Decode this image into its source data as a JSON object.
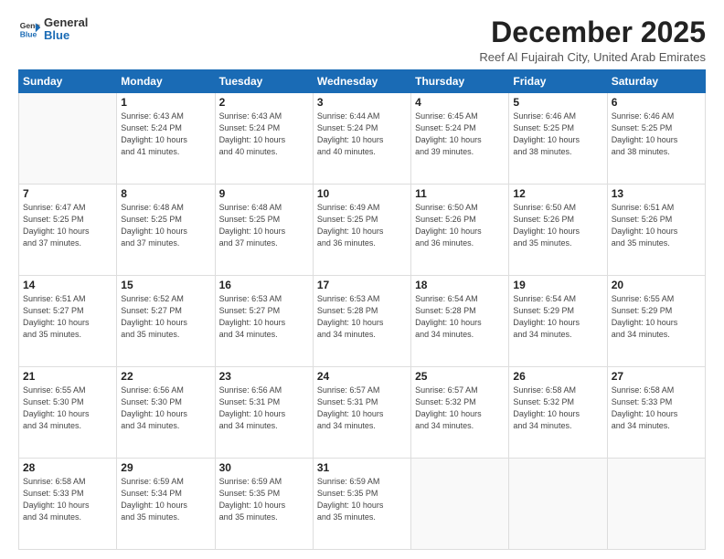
{
  "logo": {
    "general": "General",
    "blue": "Blue"
  },
  "header": {
    "month": "December 2025",
    "location": "Reef Al Fujairah City, United Arab Emirates"
  },
  "weekdays": [
    "Sunday",
    "Monday",
    "Tuesday",
    "Wednesday",
    "Thursday",
    "Friday",
    "Saturday"
  ],
  "weeks": [
    [
      {
        "day": "",
        "info": ""
      },
      {
        "day": "1",
        "info": "Sunrise: 6:43 AM\nSunset: 5:24 PM\nDaylight: 10 hours\nand 41 minutes."
      },
      {
        "day": "2",
        "info": "Sunrise: 6:43 AM\nSunset: 5:24 PM\nDaylight: 10 hours\nand 40 minutes."
      },
      {
        "day": "3",
        "info": "Sunrise: 6:44 AM\nSunset: 5:24 PM\nDaylight: 10 hours\nand 40 minutes."
      },
      {
        "day": "4",
        "info": "Sunrise: 6:45 AM\nSunset: 5:24 PM\nDaylight: 10 hours\nand 39 minutes."
      },
      {
        "day": "5",
        "info": "Sunrise: 6:46 AM\nSunset: 5:25 PM\nDaylight: 10 hours\nand 38 minutes."
      },
      {
        "day": "6",
        "info": "Sunrise: 6:46 AM\nSunset: 5:25 PM\nDaylight: 10 hours\nand 38 minutes."
      }
    ],
    [
      {
        "day": "7",
        "info": "Sunrise: 6:47 AM\nSunset: 5:25 PM\nDaylight: 10 hours\nand 37 minutes."
      },
      {
        "day": "8",
        "info": "Sunrise: 6:48 AM\nSunset: 5:25 PM\nDaylight: 10 hours\nand 37 minutes."
      },
      {
        "day": "9",
        "info": "Sunrise: 6:48 AM\nSunset: 5:25 PM\nDaylight: 10 hours\nand 37 minutes."
      },
      {
        "day": "10",
        "info": "Sunrise: 6:49 AM\nSunset: 5:25 PM\nDaylight: 10 hours\nand 36 minutes."
      },
      {
        "day": "11",
        "info": "Sunrise: 6:50 AM\nSunset: 5:26 PM\nDaylight: 10 hours\nand 36 minutes."
      },
      {
        "day": "12",
        "info": "Sunrise: 6:50 AM\nSunset: 5:26 PM\nDaylight: 10 hours\nand 35 minutes."
      },
      {
        "day": "13",
        "info": "Sunrise: 6:51 AM\nSunset: 5:26 PM\nDaylight: 10 hours\nand 35 minutes."
      }
    ],
    [
      {
        "day": "14",
        "info": "Sunrise: 6:51 AM\nSunset: 5:27 PM\nDaylight: 10 hours\nand 35 minutes."
      },
      {
        "day": "15",
        "info": "Sunrise: 6:52 AM\nSunset: 5:27 PM\nDaylight: 10 hours\nand 35 minutes."
      },
      {
        "day": "16",
        "info": "Sunrise: 6:53 AM\nSunset: 5:27 PM\nDaylight: 10 hours\nand 34 minutes."
      },
      {
        "day": "17",
        "info": "Sunrise: 6:53 AM\nSunset: 5:28 PM\nDaylight: 10 hours\nand 34 minutes."
      },
      {
        "day": "18",
        "info": "Sunrise: 6:54 AM\nSunset: 5:28 PM\nDaylight: 10 hours\nand 34 minutes."
      },
      {
        "day": "19",
        "info": "Sunrise: 6:54 AM\nSunset: 5:29 PM\nDaylight: 10 hours\nand 34 minutes."
      },
      {
        "day": "20",
        "info": "Sunrise: 6:55 AM\nSunset: 5:29 PM\nDaylight: 10 hours\nand 34 minutes."
      }
    ],
    [
      {
        "day": "21",
        "info": "Sunrise: 6:55 AM\nSunset: 5:30 PM\nDaylight: 10 hours\nand 34 minutes."
      },
      {
        "day": "22",
        "info": "Sunrise: 6:56 AM\nSunset: 5:30 PM\nDaylight: 10 hours\nand 34 minutes."
      },
      {
        "day": "23",
        "info": "Sunrise: 6:56 AM\nSunset: 5:31 PM\nDaylight: 10 hours\nand 34 minutes."
      },
      {
        "day": "24",
        "info": "Sunrise: 6:57 AM\nSunset: 5:31 PM\nDaylight: 10 hours\nand 34 minutes."
      },
      {
        "day": "25",
        "info": "Sunrise: 6:57 AM\nSunset: 5:32 PM\nDaylight: 10 hours\nand 34 minutes."
      },
      {
        "day": "26",
        "info": "Sunrise: 6:58 AM\nSunset: 5:32 PM\nDaylight: 10 hours\nand 34 minutes."
      },
      {
        "day": "27",
        "info": "Sunrise: 6:58 AM\nSunset: 5:33 PM\nDaylight: 10 hours\nand 34 minutes."
      }
    ],
    [
      {
        "day": "28",
        "info": "Sunrise: 6:58 AM\nSunset: 5:33 PM\nDaylight: 10 hours\nand 34 minutes."
      },
      {
        "day": "29",
        "info": "Sunrise: 6:59 AM\nSunset: 5:34 PM\nDaylight: 10 hours\nand 35 minutes."
      },
      {
        "day": "30",
        "info": "Sunrise: 6:59 AM\nSunset: 5:35 PM\nDaylight: 10 hours\nand 35 minutes."
      },
      {
        "day": "31",
        "info": "Sunrise: 6:59 AM\nSunset: 5:35 PM\nDaylight: 10 hours\nand 35 minutes."
      },
      {
        "day": "",
        "info": ""
      },
      {
        "day": "",
        "info": ""
      },
      {
        "day": "",
        "info": ""
      }
    ]
  ]
}
